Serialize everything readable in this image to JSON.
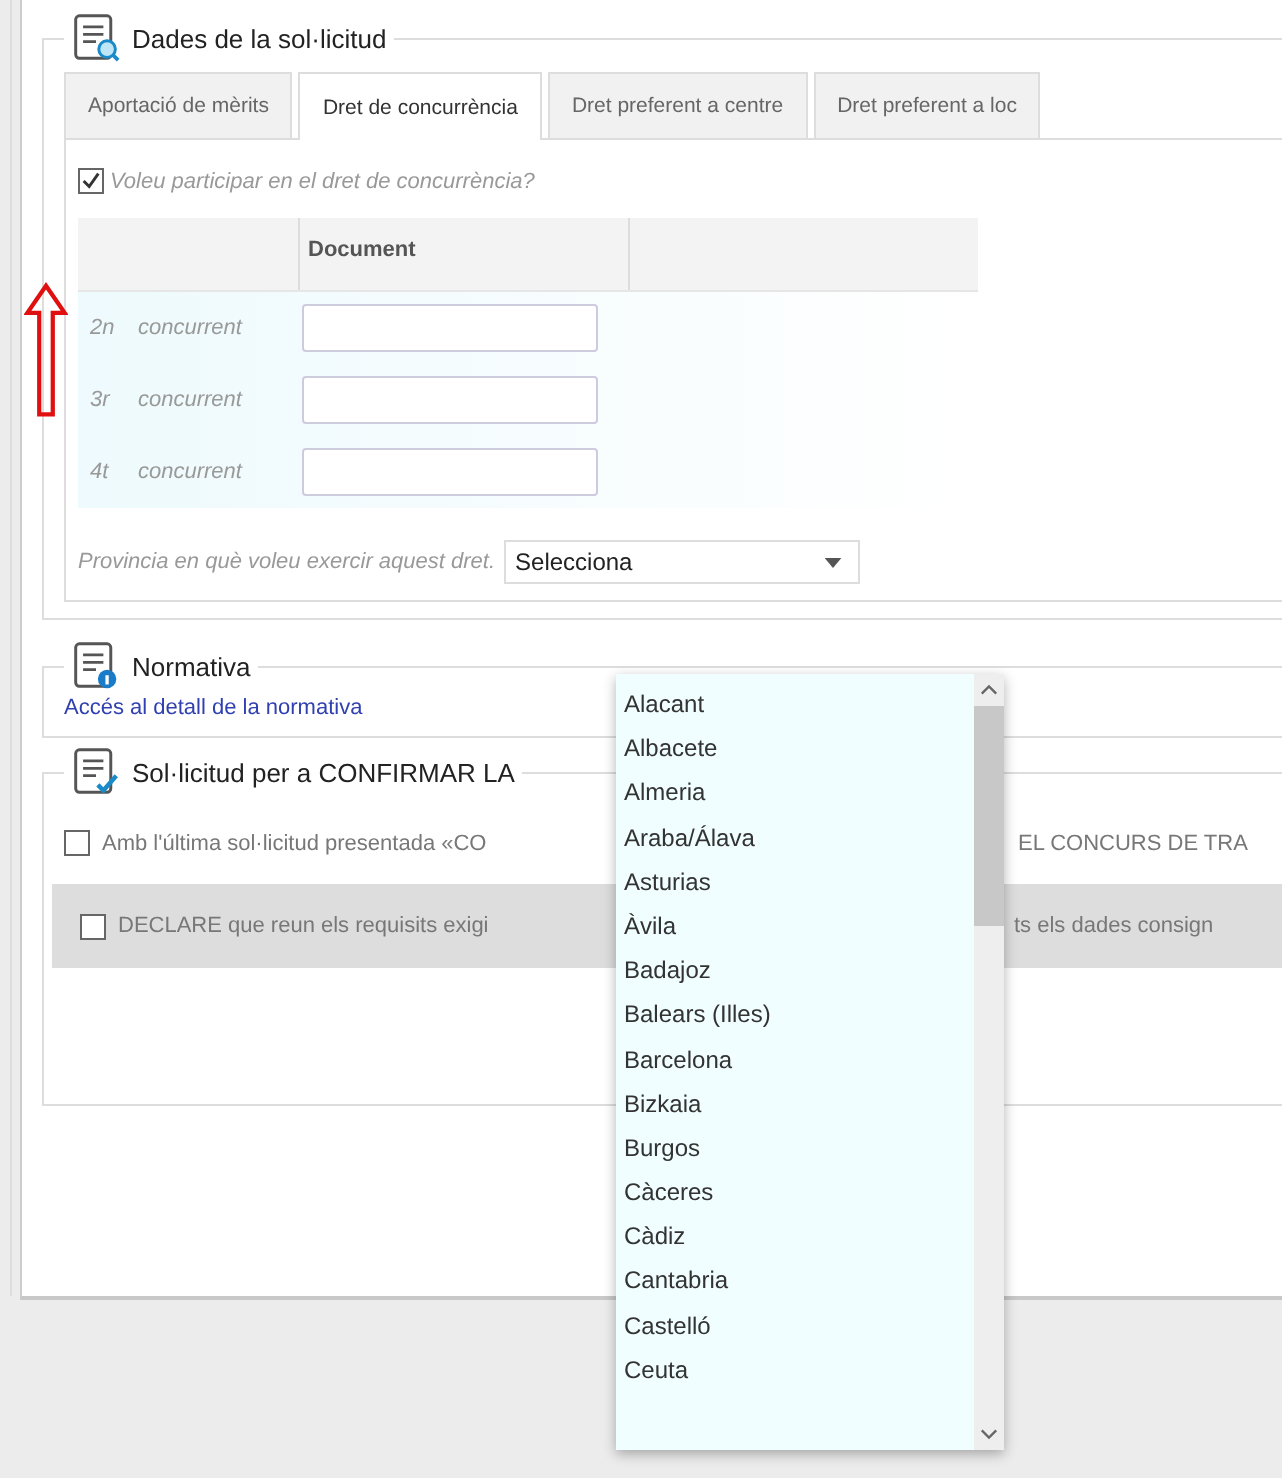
{
  "request": {
    "title": "Dades de la sol·licitud",
    "tabs": [
      {
        "label": "Aportació de mèrits",
        "selected": false
      },
      {
        "label": "Dret de concurrència",
        "selected": true
      },
      {
        "label": "Dret preferent a centre",
        "selected": false
      },
      {
        "label": "Dret preferent a loc",
        "selected": false
      }
    ],
    "participate": {
      "label": "Voleu participar en el dret de concurrència?",
      "checked": true
    },
    "table": {
      "columns": [
        "Document"
      ],
      "rows": [
        {
          "ordinal": "2n",
          "label": "concurrent"
        },
        {
          "ordinal": "3r",
          "label": "concurrent"
        },
        {
          "ordinal": "4t",
          "label": "concurrent"
        }
      ]
    },
    "province": {
      "label": "Provincia en què voleu exercir aquest dret.",
      "value": "Selecciona"
    }
  },
  "dropdown": {
    "options": [
      "Alacant",
      "Albacete",
      "Almeria",
      "Araba/Álava",
      "Asturias",
      "Àvila",
      "Badajoz",
      "Balears (Illes)",
      "Barcelona",
      "Bizkaia",
      "Burgos",
      "Càceres",
      "Càdiz",
      "Cantabria",
      "Castelló",
      "Ceuta"
    ]
  },
  "regulations": {
    "title": "Normativa",
    "link": "Accés al detall de la normativa"
  },
  "confirm": {
    "title": "Sol·licitud per a CONFIRMAR LA",
    "items": [
      {
        "kind": "plain",
        "checked": false,
        "text_before": "Amb l'última sol·licitud presentada «CO",
        "text_after": "EL CONCURS DE TRA"
      },
      {
        "kind": "band",
        "checked": false,
        "text_before": "DECLARE que reun els requisits exigi",
        "text_after": "ts els dades consign"
      }
    ]
  }
}
